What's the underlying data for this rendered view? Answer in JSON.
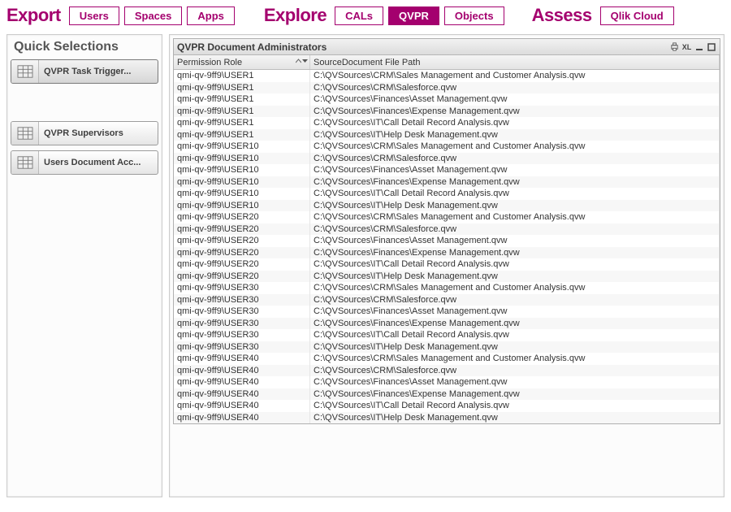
{
  "top": {
    "export": {
      "label": "Export",
      "users": "Users",
      "spaces": "Spaces",
      "apps": "Apps"
    },
    "explore": {
      "label": "Explore",
      "cals": "CALs",
      "qvpr": "QVPR",
      "objects": "Objects"
    },
    "assess": {
      "label": "Assess",
      "qlikcloud": "Qlik Cloud"
    }
  },
  "sidebar": {
    "title": "Quick Selections",
    "items": [
      {
        "label": "QVPR Task Trigger..."
      },
      {
        "label": "QVPR Supervisors"
      },
      {
        "label": "Users Document Acc..."
      }
    ]
  },
  "object": {
    "title": "QVPR Document Administrators",
    "xl": "XL",
    "columns": [
      "Permission Role",
      "SourceDocument File Path"
    ],
    "rows": [
      [
        "qmi-qv-9ff9\\USER1",
        "C:\\QVSources\\CRM\\Sales Management and Customer Analysis.qvw"
      ],
      [
        "qmi-qv-9ff9\\USER1",
        "C:\\QVSources\\CRM\\Salesforce.qvw"
      ],
      [
        "qmi-qv-9ff9\\USER1",
        "C:\\QVSources\\Finances\\Asset Management.qvw"
      ],
      [
        "qmi-qv-9ff9\\USER1",
        "C:\\QVSources\\Finances\\Expense Management.qvw"
      ],
      [
        "qmi-qv-9ff9\\USER1",
        "C:\\QVSources\\IT\\Call Detail Record Analysis.qvw"
      ],
      [
        "qmi-qv-9ff9\\USER1",
        "C:\\QVSources\\IT\\Help Desk Management.qvw"
      ],
      [
        "qmi-qv-9ff9\\USER10",
        "C:\\QVSources\\CRM\\Sales Management and Customer Analysis.qvw"
      ],
      [
        "qmi-qv-9ff9\\USER10",
        "C:\\QVSources\\CRM\\Salesforce.qvw"
      ],
      [
        "qmi-qv-9ff9\\USER10",
        "C:\\QVSources\\Finances\\Asset Management.qvw"
      ],
      [
        "qmi-qv-9ff9\\USER10",
        "C:\\QVSources\\Finances\\Expense Management.qvw"
      ],
      [
        "qmi-qv-9ff9\\USER10",
        "C:\\QVSources\\IT\\Call Detail Record Analysis.qvw"
      ],
      [
        "qmi-qv-9ff9\\USER10",
        "C:\\QVSources\\IT\\Help Desk Management.qvw"
      ],
      [
        "qmi-qv-9ff9\\USER20",
        "C:\\QVSources\\CRM\\Sales Management and Customer Analysis.qvw"
      ],
      [
        "qmi-qv-9ff9\\USER20",
        "C:\\QVSources\\CRM\\Salesforce.qvw"
      ],
      [
        "qmi-qv-9ff9\\USER20",
        "C:\\QVSources\\Finances\\Asset Management.qvw"
      ],
      [
        "qmi-qv-9ff9\\USER20",
        "C:\\QVSources\\Finances\\Expense Management.qvw"
      ],
      [
        "qmi-qv-9ff9\\USER20",
        "C:\\QVSources\\IT\\Call Detail Record Analysis.qvw"
      ],
      [
        "qmi-qv-9ff9\\USER20",
        "C:\\QVSources\\IT\\Help Desk Management.qvw"
      ],
      [
        "qmi-qv-9ff9\\USER30",
        "C:\\QVSources\\CRM\\Sales Management and Customer Analysis.qvw"
      ],
      [
        "qmi-qv-9ff9\\USER30",
        "C:\\QVSources\\CRM\\Salesforce.qvw"
      ],
      [
        "qmi-qv-9ff9\\USER30",
        "C:\\QVSources\\Finances\\Asset Management.qvw"
      ],
      [
        "qmi-qv-9ff9\\USER30",
        "C:\\QVSources\\Finances\\Expense Management.qvw"
      ],
      [
        "qmi-qv-9ff9\\USER30",
        "C:\\QVSources\\IT\\Call Detail Record Analysis.qvw"
      ],
      [
        "qmi-qv-9ff9\\USER30",
        "C:\\QVSources\\IT\\Help Desk Management.qvw"
      ],
      [
        "qmi-qv-9ff9\\USER40",
        "C:\\QVSources\\CRM\\Sales Management and Customer Analysis.qvw"
      ],
      [
        "qmi-qv-9ff9\\USER40",
        "C:\\QVSources\\CRM\\Salesforce.qvw"
      ],
      [
        "qmi-qv-9ff9\\USER40",
        "C:\\QVSources\\Finances\\Asset Management.qvw"
      ],
      [
        "qmi-qv-9ff9\\USER40",
        "C:\\QVSources\\Finances\\Expense Management.qvw"
      ],
      [
        "qmi-qv-9ff9\\USER40",
        "C:\\QVSources\\IT\\Call Detail Record Analysis.qvw"
      ],
      [
        "qmi-qv-9ff9\\USER40",
        "C:\\QVSources\\IT\\Help Desk Management.qvw"
      ]
    ]
  }
}
